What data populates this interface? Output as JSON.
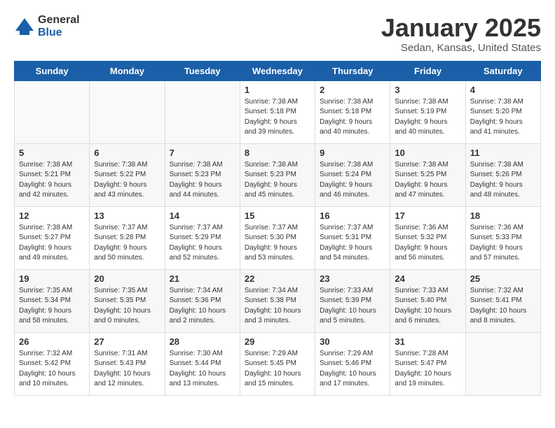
{
  "header": {
    "logo_general": "General",
    "logo_blue": "Blue",
    "title": "January 2025",
    "subtitle": "Sedan, Kansas, United States"
  },
  "days_of_week": [
    "Sunday",
    "Monday",
    "Tuesday",
    "Wednesday",
    "Thursday",
    "Friday",
    "Saturday"
  ],
  "weeks": [
    [
      {
        "day": "",
        "text": ""
      },
      {
        "day": "",
        "text": ""
      },
      {
        "day": "",
        "text": ""
      },
      {
        "day": "1",
        "text": "Sunrise: 7:38 AM\nSunset: 5:18 PM\nDaylight: 9 hours and 39 minutes."
      },
      {
        "day": "2",
        "text": "Sunrise: 7:38 AM\nSunset: 5:18 PM\nDaylight: 9 hours and 40 minutes."
      },
      {
        "day": "3",
        "text": "Sunrise: 7:38 AM\nSunset: 5:19 PM\nDaylight: 9 hours and 40 minutes."
      },
      {
        "day": "4",
        "text": "Sunrise: 7:38 AM\nSunset: 5:20 PM\nDaylight: 9 hours and 41 minutes."
      }
    ],
    [
      {
        "day": "5",
        "text": "Sunrise: 7:38 AM\nSunset: 5:21 PM\nDaylight: 9 hours and 42 minutes."
      },
      {
        "day": "6",
        "text": "Sunrise: 7:38 AM\nSunset: 5:22 PM\nDaylight: 9 hours and 43 minutes."
      },
      {
        "day": "7",
        "text": "Sunrise: 7:38 AM\nSunset: 5:23 PM\nDaylight: 9 hours and 44 minutes."
      },
      {
        "day": "8",
        "text": "Sunrise: 7:38 AM\nSunset: 5:23 PM\nDaylight: 9 hours and 45 minutes."
      },
      {
        "day": "9",
        "text": "Sunrise: 7:38 AM\nSunset: 5:24 PM\nDaylight: 9 hours and 46 minutes."
      },
      {
        "day": "10",
        "text": "Sunrise: 7:38 AM\nSunset: 5:25 PM\nDaylight: 9 hours and 47 minutes."
      },
      {
        "day": "11",
        "text": "Sunrise: 7:38 AM\nSunset: 5:26 PM\nDaylight: 9 hours and 48 minutes."
      }
    ],
    [
      {
        "day": "12",
        "text": "Sunrise: 7:38 AM\nSunset: 5:27 PM\nDaylight: 9 hours and 49 minutes."
      },
      {
        "day": "13",
        "text": "Sunrise: 7:37 AM\nSunset: 5:28 PM\nDaylight: 9 hours and 50 minutes."
      },
      {
        "day": "14",
        "text": "Sunrise: 7:37 AM\nSunset: 5:29 PM\nDaylight: 9 hours and 52 minutes."
      },
      {
        "day": "15",
        "text": "Sunrise: 7:37 AM\nSunset: 5:30 PM\nDaylight: 9 hours and 53 minutes."
      },
      {
        "day": "16",
        "text": "Sunrise: 7:37 AM\nSunset: 5:31 PM\nDaylight: 9 hours and 54 minutes."
      },
      {
        "day": "17",
        "text": "Sunrise: 7:36 AM\nSunset: 5:32 PM\nDaylight: 9 hours and 56 minutes."
      },
      {
        "day": "18",
        "text": "Sunrise: 7:36 AM\nSunset: 5:33 PM\nDaylight: 9 hours and 57 minutes."
      }
    ],
    [
      {
        "day": "19",
        "text": "Sunrise: 7:35 AM\nSunset: 5:34 PM\nDaylight: 9 hours and 58 minutes."
      },
      {
        "day": "20",
        "text": "Sunrise: 7:35 AM\nSunset: 5:35 PM\nDaylight: 10 hours and 0 minutes."
      },
      {
        "day": "21",
        "text": "Sunrise: 7:34 AM\nSunset: 5:36 PM\nDaylight: 10 hours and 2 minutes."
      },
      {
        "day": "22",
        "text": "Sunrise: 7:34 AM\nSunset: 5:38 PM\nDaylight: 10 hours and 3 minutes."
      },
      {
        "day": "23",
        "text": "Sunrise: 7:33 AM\nSunset: 5:39 PM\nDaylight: 10 hours and 5 minutes."
      },
      {
        "day": "24",
        "text": "Sunrise: 7:33 AM\nSunset: 5:40 PM\nDaylight: 10 hours and 6 minutes."
      },
      {
        "day": "25",
        "text": "Sunrise: 7:32 AM\nSunset: 5:41 PM\nDaylight: 10 hours and 8 minutes."
      }
    ],
    [
      {
        "day": "26",
        "text": "Sunrise: 7:32 AM\nSunset: 5:42 PM\nDaylight: 10 hours and 10 minutes."
      },
      {
        "day": "27",
        "text": "Sunrise: 7:31 AM\nSunset: 5:43 PM\nDaylight: 10 hours and 12 minutes."
      },
      {
        "day": "28",
        "text": "Sunrise: 7:30 AM\nSunset: 5:44 PM\nDaylight: 10 hours and 13 minutes."
      },
      {
        "day": "29",
        "text": "Sunrise: 7:29 AM\nSunset: 5:45 PM\nDaylight: 10 hours and 15 minutes."
      },
      {
        "day": "30",
        "text": "Sunrise: 7:29 AM\nSunset: 5:46 PM\nDaylight: 10 hours and 17 minutes."
      },
      {
        "day": "31",
        "text": "Sunrise: 7:28 AM\nSunset: 5:47 PM\nDaylight: 10 hours and 19 minutes."
      },
      {
        "day": "",
        "text": ""
      }
    ]
  ]
}
